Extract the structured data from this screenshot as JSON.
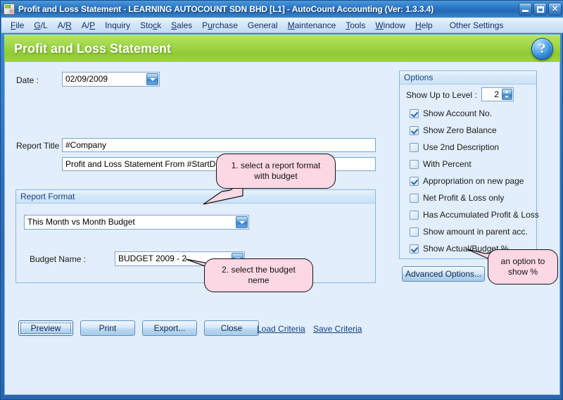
{
  "window": {
    "title": "Profit and Loss Statement - LEARNING AUTOCOUNT SDN BHD [L1] - AutoCount Accounting (Ver: 1.3.3.4)",
    "minimize_label": "Minimize",
    "maximize_label": "Maximize",
    "close_label": "Close"
  },
  "menu": {
    "items": [
      {
        "label": "File",
        "accel": "F"
      },
      {
        "label": "G/L",
        "accel": "G"
      },
      {
        "label": "A/R",
        "accel": "R"
      },
      {
        "label": "A/P",
        "accel": "P"
      },
      {
        "label": "Inquiry",
        "accel": ""
      },
      {
        "label": "Stock",
        "accel": "c"
      },
      {
        "label": "Sales",
        "accel": "S"
      },
      {
        "label": "Purchase",
        "accel": "u"
      },
      {
        "label": "General",
        "accel": ""
      },
      {
        "label": "Maintenance",
        "accel": "M"
      },
      {
        "label": "Tools",
        "accel": "T"
      },
      {
        "label": "Window",
        "accel": "W"
      },
      {
        "label": "Help",
        "accel": "H"
      },
      {
        "label": "Other Settings",
        "accel": ""
      }
    ]
  },
  "banner": {
    "title": "Profit and Loss Statement",
    "help_label": "?"
  },
  "form": {
    "date_label": "Date :",
    "date_value": "02/09/2009",
    "report_title_label": "Report Title :",
    "report_title_value": "#Company",
    "report_subtitle_value": "Profit and Loss Statement From  #StartDate to #EndDate",
    "report_format_group": "Report Format",
    "report_format_value": "This Month vs Month Budget",
    "budget_name_label": "Budget Name :",
    "budget_name_value": "BUDGET 2009 - 2"
  },
  "options": {
    "group_title": "Options",
    "level_label": "Show Up to Level :",
    "level_value": "2",
    "checkboxes": [
      {
        "label": "Show Account No.",
        "checked": true
      },
      {
        "label": "Show Zero Balance",
        "checked": true
      },
      {
        "label": "Use 2nd Description",
        "checked": false
      },
      {
        "label": "With Percent",
        "checked": false
      },
      {
        "label": "Appropriation on new page",
        "checked": true
      },
      {
        "label": "Net Profit & Loss only",
        "checked": false
      },
      {
        "label": "Has Accumulated Profit & Loss",
        "checked": false
      },
      {
        "label": "Show amount in parent acc.",
        "checked": false
      },
      {
        "label": "Show Actual/Budget %",
        "checked": true
      }
    ],
    "advanced_button": "Advanced Options..."
  },
  "actions": {
    "preview": "Preview",
    "print": "Print",
    "export": "Export...",
    "close": "Close",
    "load_criteria": "Load Criteria",
    "save_criteria": "Save Criteria"
  },
  "callouts": [
    {
      "id": "callout-report-format",
      "line1": "1. select a report format",
      "line2": "with budget"
    },
    {
      "id": "callout-budget-name",
      "line1": "2. select the budget",
      "line2": "neme"
    },
    {
      "id": "callout-show-percent",
      "line1": "an option to",
      "line2": "show %"
    }
  ],
  "colors": {
    "banner_green": "#9ed34a",
    "titlebar_blue": "#2d78c6",
    "client_bg": "#e2eefb",
    "callout_pink": "#fcd8e4",
    "link_blue": "#123f86"
  }
}
